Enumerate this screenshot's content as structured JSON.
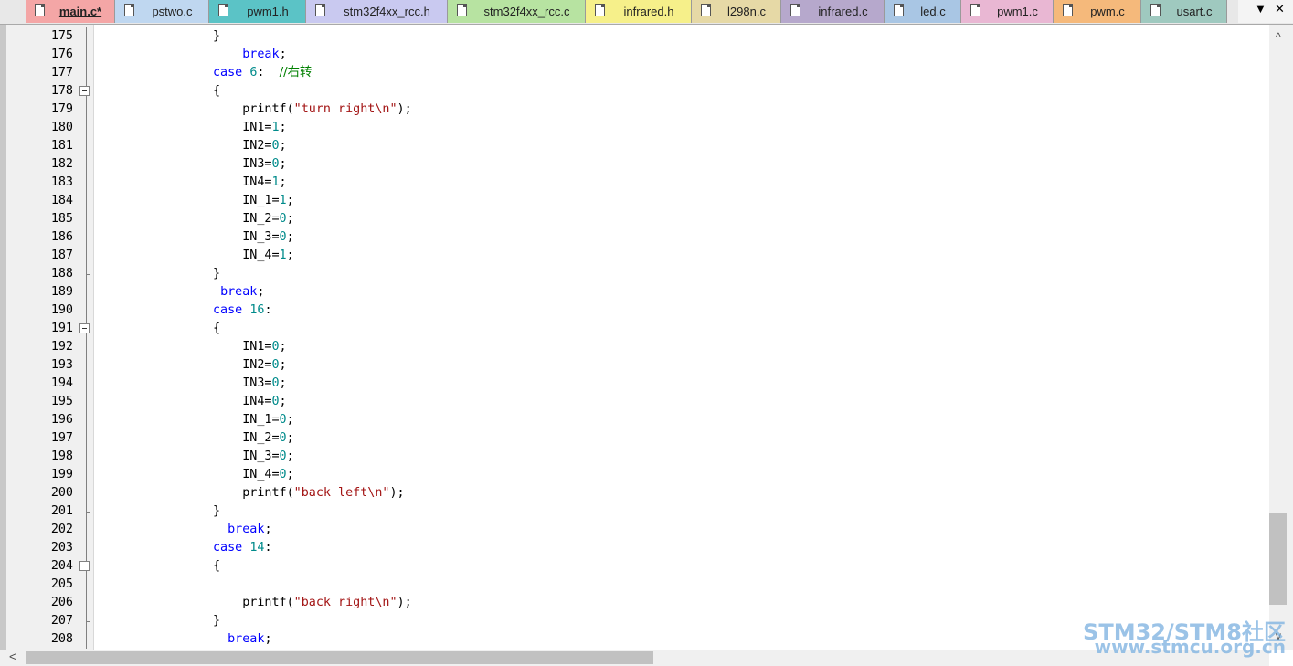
{
  "tabs": [
    {
      "label": "main.c*",
      "color": "#f4a6a6",
      "active": true
    },
    {
      "label": "pstwo.c",
      "color": "#bfd7f0",
      "active": false
    },
    {
      "label": "pwm1.h",
      "color": "#5bc3c6",
      "active": false
    },
    {
      "label": "stm32f4xx_rcc.h",
      "color": "#c9c9f0",
      "active": false
    },
    {
      "label": "stm32f4xx_rcc.c",
      "color": "#b7e3a1",
      "active": false
    },
    {
      "label": "infrared.h",
      "color": "#f6f08a",
      "active": false
    },
    {
      "label": "l298n.c",
      "color": "#e6d9a6",
      "active": false
    },
    {
      "label": "infrared.c",
      "color": "#b6a8cc",
      "active": false
    },
    {
      "label": "led.c",
      "color": "#a9c6e4",
      "active": false
    },
    {
      "label": "pwm1.c",
      "color": "#e9b7d3",
      "active": false
    },
    {
      "label": "pwm.c",
      "color": "#f5b97b",
      "active": false
    },
    {
      "label": "usart.c",
      "color": "#9fc9bf",
      "active": false
    }
  ],
  "tab_tools": {
    "dropdown_icon": "▼",
    "close_icon": "✕"
  },
  "code_colors": {
    "keyword": "#0000ff",
    "number": "#008b8b",
    "string": "#a31515",
    "comment": "#008000"
  },
  "lines": [
    {
      "n": "175",
      "fold": "end",
      "code": [
        [
          "                }",
          "p"
        ]
      ]
    },
    {
      "n": "176",
      "fold": "line",
      "code": [
        [
          "                    ",
          "p"
        ],
        [
          "break",
          "kw"
        ],
        [
          ";",
          "p"
        ]
      ]
    },
    {
      "n": "177",
      "fold": "line",
      "code": [
        [
          "                ",
          "p"
        ],
        [
          "case",
          "kw"
        ],
        [
          " ",
          "p"
        ],
        [
          "6",
          "num"
        ],
        [
          ":  ",
          "p"
        ],
        [
          "//右转",
          "cmt"
        ]
      ]
    },
    {
      "n": "178",
      "fold": "box",
      "code": [
        [
          "                {",
          "p"
        ]
      ]
    },
    {
      "n": "179",
      "fold": "line",
      "code": [
        [
          "                    printf(",
          "p"
        ],
        [
          "\"turn right\\n\"",
          "str"
        ],
        [
          ");",
          "p"
        ]
      ]
    },
    {
      "n": "180",
      "fold": "line",
      "code": [
        [
          "                    IN1=",
          "p"
        ],
        [
          "1",
          "num"
        ],
        [
          ";",
          "p"
        ]
      ]
    },
    {
      "n": "181",
      "fold": "line",
      "code": [
        [
          "                    IN2=",
          "p"
        ],
        [
          "0",
          "num"
        ],
        [
          ";",
          "p"
        ]
      ]
    },
    {
      "n": "182",
      "fold": "line",
      "code": [
        [
          "                    IN3=",
          "p"
        ],
        [
          "0",
          "num"
        ],
        [
          ";",
          "p"
        ]
      ]
    },
    {
      "n": "183",
      "fold": "line",
      "code": [
        [
          "                    IN4=",
          "p"
        ],
        [
          "1",
          "num"
        ],
        [
          ";",
          "p"
        ]
      ]
    },
    {
      "n": "184",
      "fold": "line",
      "code": [
        [
          "                    IN_1=",
          "p"
        ],
        [
          "1",
          "num"
        ],
        [
          ";",
          "p"
        ]
      ]
    },
    {
      "n": "185",
      "fold": "line",
      "code": [
        [
          "                    IN_2=",
          "p"
        ],
        [
          "0",
          "num"
        ],
        [
          ";",
          "p"
        ]
      ]
    },
    {
      "n": "186",
      "fold": "line",
      "code": [
        [
          "                    IN_3=",
          "p"
        ],
        [
          "0",
          "num"
        ],
        [
          ";",
          "p"
        ]
      ]
    },
    {
      "n": "187",
      "fold": "line",
      "code": [
        [
          "                    IN_4=",
          "p"
        ],
        [
          "1",
          "num"
        ],
        [
          ";",
          "p"
        ]
      ]
    },
    {
      "n": "188",
      "fold": "end",
      "code": [
        [
          "                }",
          "p"
        ]
      ]
    },
    {
      "n": "189",
      "fold": "line",
      "code": [
        [
          "                 ",
          "p"
        ],
        [
          "break",
          "kw"
        ],
        [
          ";",
          "p"
        ]
      ]
    },
    {
      "n": "190",
      "fold": "line",
      "code": [
        [
          "                ",
          "p"
        ],
        [
          "case",
          "kw"
        ],
        [
          " ",
          "p"
        ],
        [
          "16",
          "num"
        ],
        [
          ":",
          "p"
        ]
      ]
    },
    {
      "n": "191",
      "fold": "box",
      "code": [
        [
          "                {",
          "p"
        ]
      ]
    },
    {
      "n": "192",
      "fold": "line",
      "code": [
        [
          "                    IN1=",
          "p"
        ],
        [
          "0",
          "num"
        ],
        [
          ";",
          "p"
        ]
      ]
    },
    {
      "n": "193",
      "fold": "line",
      "code": [
        [
          "                    IN2=",
          "p"
        ],
        [
          "0",
          "num"
        ],
        [
          ";",
          "p"
        ]
      ]
    },
    {
      "n": "194",
      "fold": "line",
      "code": [
        [
          "                    IN3=",
          "p"
        ],
        [
          "0",
          "num"
        ],
        [
          ";",
          "p"
        ]
      ]
    },
    {
      "n": "195",
      "fold": "line",
      "code": [
        [
          "                    IN4=",
          "p"
        ],
        [
          "0",
          "num"
        ],
        [
          ";",
          "p"
        ]
      ]
    },
    {
      "n": "196",
      "fold": "line",
      "code": [
        [
          "                    IN_1=",
          "p"
        ],
        [
          "0",
          "num"
        ],
        [
          ";",
          "p"
        ]
      ]
    },
    {
      "n": "197",
      "fold": "line",
      "code": [
        [
          "                    IN_2=",
          "p"
        ],
        [
          "0",
          "num"
        ],
        [
          ";",
          "p"
        ]
      ]
    },
    {
      "n": "198",
      "fold": "line",
      "code": [
        [
          "                    IN_3=",
          "p"
        ],
        [
          "0",
          "num"
        ],
        [
          ";",
          "p"
        ]
      ]
    },
    {
      "n": "199",
      "fold": "line",
      "code": [
        [
          "                    IN_4=",
          "p"
        ],
        [
          "0",
          "num"
        ],
        [
          ";",
          "p"
        ]
      ]
    },
    {
      "n": "200",
      "fold": "line",
      "code": [
        [
          "                    printf(",
          "p"
        ],
        [
          "\"back left\\n\"",
          "str"
        ],
        [
          ");",
          "p"
        ]
      ]
    },
    {
      "n": "201",
      "fold": "end",
      "code": [
        [
          "                }",
          "p"
        ]
      ]
    },
    {
      "n": "202",
      "fold": "line",
      "code": [
        [
          "                  ",
          "p"
        ],
        [
          "break",
          "kw"
        ],
        [
          ";",
          "p"
        ]
      ]
    },
    {
      "n": "203",
      "fold": "line",
      "code": [
        [
          "                ",
          "p"
        ],
        [
          "case",
          "kw"
        ],
        [
          " ",
          "p"
        ],
        [
          "14",
          "num"
        ],
        [
          ":",
          "p"
        ]
      ]
    },
    {
      "n": "204",
      "fold": "box",
      "code": [
        [
          "                {",
          "p"
        ]
      ]
    },
    {
      "n": "205",
      "fold": "line",
      "code": []
    },
    {
      "n": "206",
      "fold": "line",
      "code": [
        [
          "                    printf(",
          "p"
        ],
        [
          "\"back right\\n\"",
          "str"
        ],
        [
          ");",
          "p"
        ]
      ]
    },
    {
      "n": "207",
      "fold": "end",
      "code": [
        [
          "                }",
          "p"
        ]
      ]
    },
    {
      "n": "208",
      "fold": "line",
      "code": [
        [
          "                  ",
          "p"
        ],
        [
          "break",
          "kw"
        ],
        [
          ";",
          "p"
        ]
      ]
    }
  ],
  "scroll": {
    "up_icon": "^",
    "down_icon": "v",
    "left_icon": "<"
  },
  "watermark": {
    "line1": "STM32/STM8社区",
    "line2": "www.stmcu.org.cn"
  }
}
